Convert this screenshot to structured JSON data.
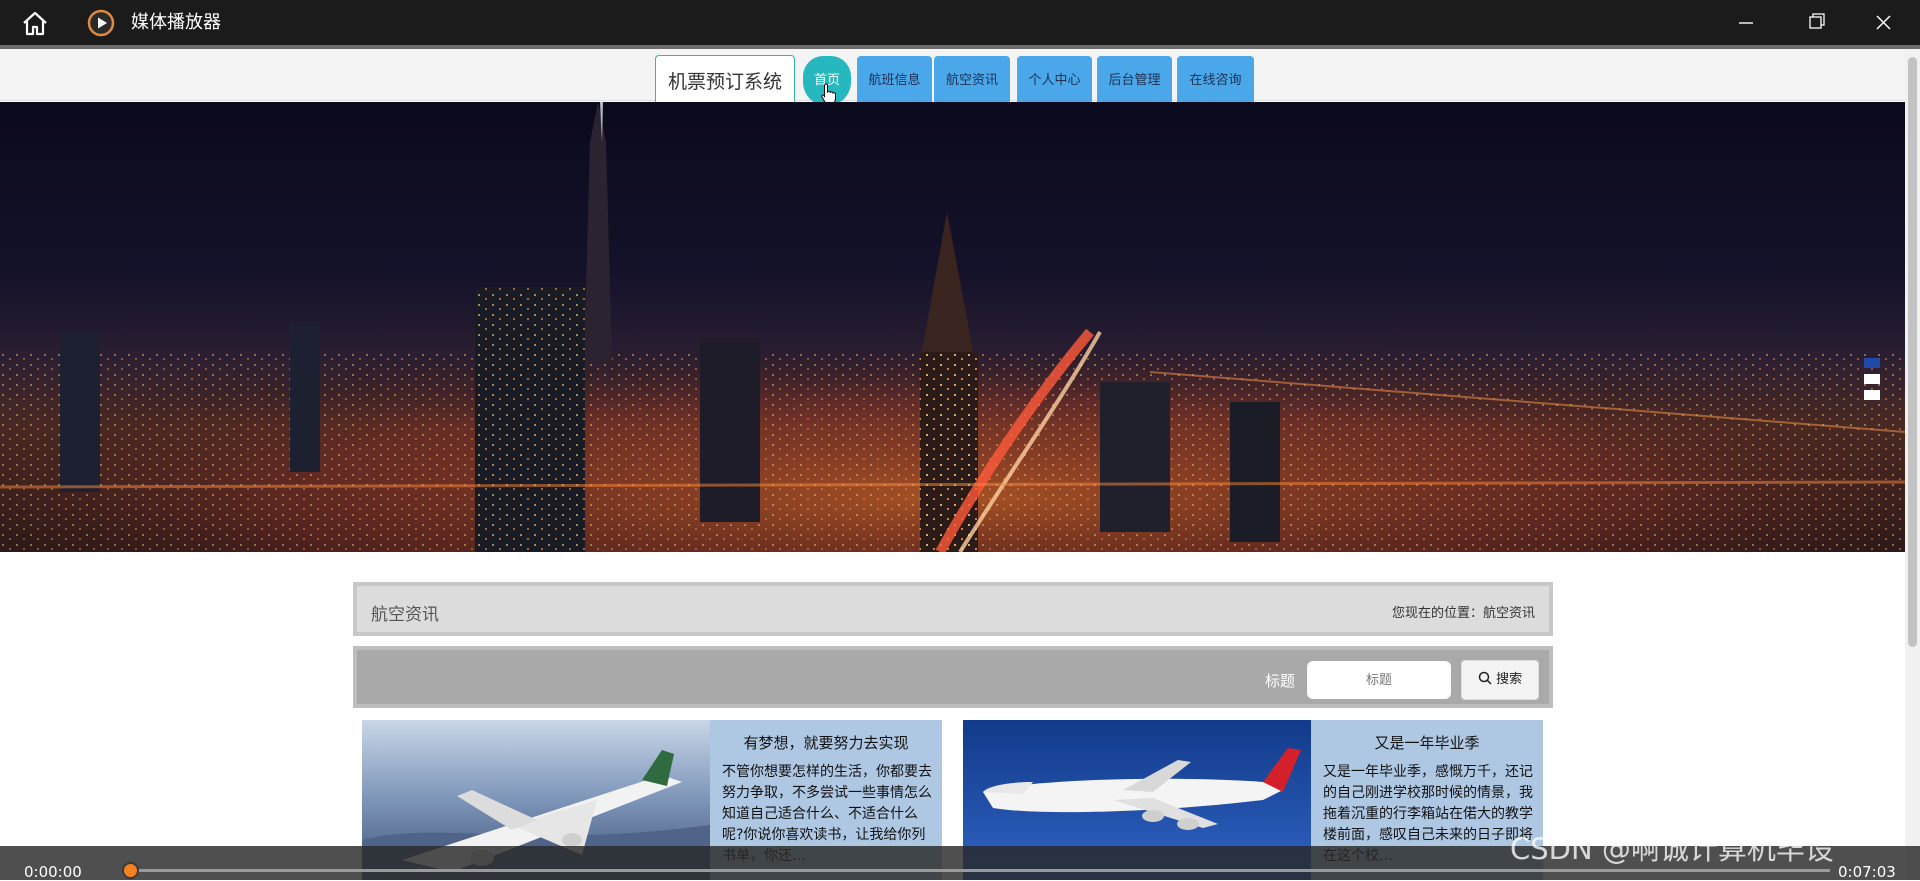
{
  "window": {
    "app_title": "媒体播放器",
    "icons": {
      "home": "home-icon",
      "app": "play-circle-icon",
      "minimize": "minimize-icon",
      "maximize": "restore-icon",
      "close": "close-icon"
    }
  },
  "nav": {
    "brand": "机票预订系统",
    "items": [
      {
        "label": "首页",
        "active": true
      },
      {
        "label": "航班信息",
        "active": false
      },
      {
        "label": "航空资讯",
        "active": false
      },
      {
        "label": "个人中心",
        "active": false
      },
      {
        "label": "后台管理",
        "active": false
      },
      {
        "label": "在线咨询",
        "active": false
      }
    ]
  },
  "banner": {
    "image": "city-night-skyline",
    "slides": 3,
    "active_slide": 1
  },
  "page": {
    "section_title": "航空资讯",
    "location": "您现在的位置：航空资讯"
  },
  "search": {
    "label": "标题",
    "placeholder": "标题",
    "button": "搜索",
    "icon": "search-icon"
  },
  "articles": [
    {
      "title": "有梦想，就要努力去实现",
      "excerpt": "不管你想要怎样的生活，你都要去努力争取，不多尝试一些事情怎么知道自己适合什么、不适合什么呢?你说你喜欢读书，让我给你列书单，你还…",
      "image": "eva-air-plane-over-clouds"
    },
    {
      "title": "又是一年毕业季",
      "excerpt": "又是一年毕业季，感慨万千，还记的自己刚进学校那时候的情景，我拖着沉重的行李箱站在偌大的教学楼前面，感叹自己未来的日子即将在这个校…",
      "image": "qantas-747-blue-sky"
    }
  ],
  "player": {
    "current_time": "0:00:00",
    "total_time": "0:07:03",
    "progress": 0
  },
  "watermark": "CSDN @啊诚计算机毕设",
  "colors": {
    "titlebar": "#1b1b1b",
    "nav_button": "#4aa8ea",
    "nav_active": "#27b7bf",
    "brand_border": "#3bb3a5",
    "card_bg": "#aec7e3",
    "seek_knob": "#f58220"
  }
}
